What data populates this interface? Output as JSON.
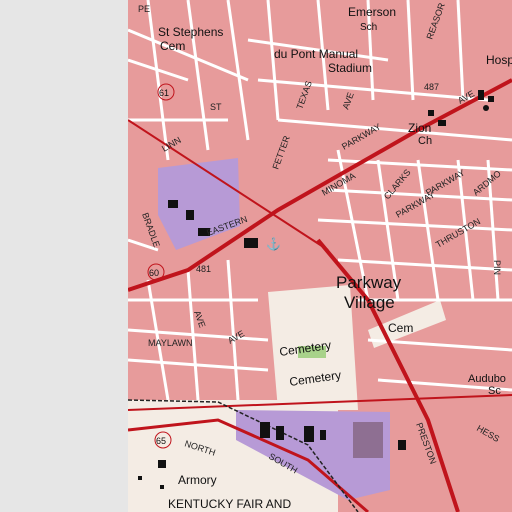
{
  "map": {
    "labels": {
      "st_stephens_cem_1": "St Stephens",
      "st_stephens_cem_2": "Cem",
      "emerson_1": "Emerson",
      "emerson_2": "Sch",
      "dupont_1": "du Pont Manual",
      "dupont_2": "Stadium",
      "hosp": "Hosp",
      "zion_1": "Zion",
      "zion_2": "Ch",
      "parkway_village_1": "Parkway",
      "parkway_village_2": "Village",
      "cem": "Cem",
      "cemetery_1": "Cemetery",
      "cemetery_2": "Cemetery",
      "audubon_1": "Audubo",
      "audubon_2": "Sc",
      "armory": "Armory",
      "kentucky_fair": "KENTUCKY FAIR AND",
      "fair_cut": "Sc"
    },
    "roads": {
      "st": "ST",
      "texas": "TEXAS",
      "ave_1": "AVE",
      "ave_2": "AVE",
      "ave_3": "AVE",
      "ave_4": "AVE",
      "reasor": "REASOR",
      "linn": "LINN",
      "fetter": "FETTER",
      "parkway_1": "PARKWAY",
      "parkway_2": "PARKWAY",
      "parkway_3": "PARKWAY",
      "minoma": "MINOMA",
      "clarks": "CLARKS",
      "ardmore": "ARDMO",
      "thruston": "THRUSTON",
      "eastern": "EASTERN",
      "bradley": "BRADLE",
      "maylawn": "MAYLAWN",
      "north": "NORTH",
      "south": "SOUTH",
      "hess": "HESS",
      "preston": "PRESTON",
      "pe": "PE",
      "pin": "PIN"
    },
    "routes": {
      "r61": "61",
      "r60": "60",
      "r65": "65",
      "r481": "481",
      "r487": "487"
    },
    "colors": {
      "urban_tint": "#e79b9b",
      "street": "#ffffff",
      "major_road": "#c0141c",
      "institution": "#b79ad6",
      "park": "#a8d28a",
      "cemetery_bg": "#f4ece4"
    }
  }
}
